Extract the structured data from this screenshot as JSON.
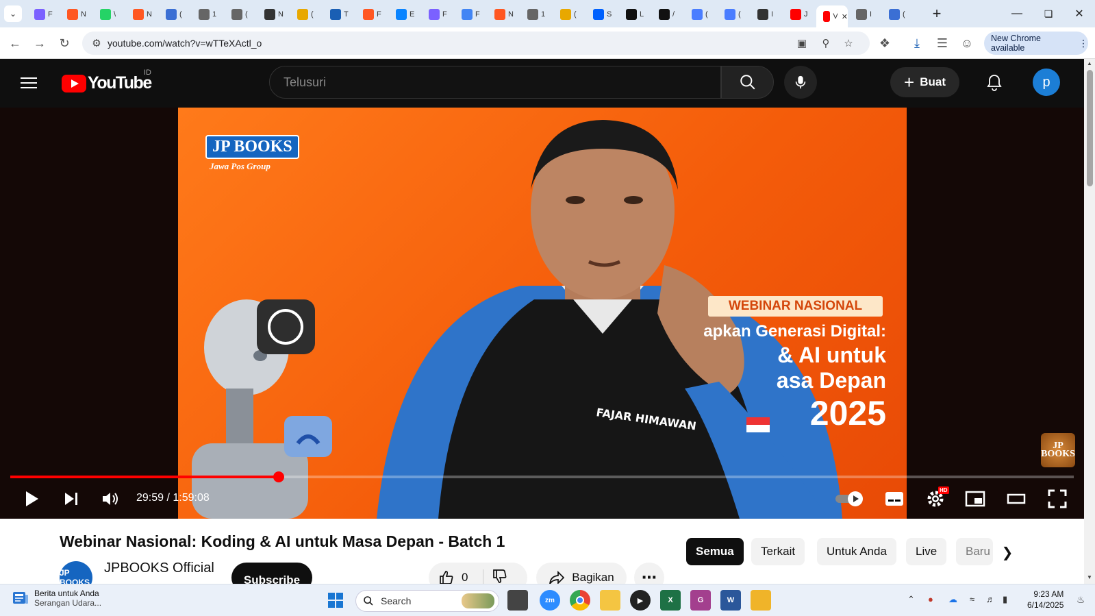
{
  "browser": {
    "tabs": [
      {
        "icon": "app-icon",
        "color": "#7b61ff",
        "text": "F"
      },
      {
        "icon": "blogger-icon",
        "color": "#ff5722",
        "text": "N"
      },
      {
        "icon": "whatsapp-icon",
        "color": "#25d366",
        "text": "\\"
      },
      {
        "icon": "blogger-icon",
        "color": "#ff5722",
        "text": "N"
      },
      {
        "icon": "doc-icon",
        "color": "#3b6fd4",
        "text": "("
      },
      {
        "icon": "globe-icon",
        "color": "#666",
        "text": "1"
      },
      {
        "icon": "globe-icon",
        "color": "#666",
        "text": "("
      },
      {
        "icon": "chatgpt-icon",
        "color": "#333",
        "text": "N"
      },
      {
        "icon": "app-icon",
        "color": "#e8a800",
        "text": "("
      },
      {
        "icon": "tm-icon",
        "color": "#1a5fb4",
        "text": "T"
      },
      {
        "icon": "blogger-icon",
        "color": "#ff5722",
        "text": "F"
      },
      {
        "icon": "edge-icon",
        "color": "#0a84ff",
        "text": "E"
      },
      {
        "icon": "app-icon",
        "color": "#7b61ff",
        "text": "F"
      },
      {
        "icon": "google-icon",
        "color": "#4285f4",
        "text": "F"
      },
      {
        "icon": "blogger-icon",
        "color": "#ff5722",
        "text": "N"
      },
      {
        "icon": "globe-icon",
        "color": "#666",
        "text": "1"
      },
      {
        "icon": "app-icon",
        "color": "#e8a800",
        "text": "("
      },
      {
        "icon": "dropbox-icon",
        "color": "#0061fe",
        "text": "S"
      },
      {
        "icon": "qr-icon",
        "color": "#111",
        "text": "L"
      },
      {
        "icon": "qr-icon",
        "color": "#111",
        "text": "/"
      },
      {
        "icon": "gemini-icon",
        "color": "#4a7dff",
        "text": "("
      },
      {
        "icon": "gemini-icon",
        "color": "#4a7dff",
        "text": "("
      },
      {
        "icon": "chatgpt-icon",
        "color": "#333",
        "text": "I"
      },
      {
        "icon": "youtube-icon",
        "color": "#ff0000",
        "text": "J"
      },
      {
        "icon": "youtube-icon",
        "color": "#ff0000",
        "text": "V",
        "active": true
      },
      {
        "icon": "globe-icon",
        "color": "#666",
        "text": "I"
      },
      {
        "icon": "app-icon",
        "color": "#3b6fd4",
        "text": "("
      }
    ],
    "url": "youtube.com/watch?v=wTTeXActl_o",
    "new_chrome_label": "New Chrome available"
  },
  "youtube": {
    "logo_text": "YouTube",
    "region": "ID",
    "search_placeholder": "Telusuri",
    "create_label": "Buat",
    "avatar_letter": "p"
  },
  "video": {
    "brand_box": "JP BOOKS",
    "brand_sub": "Jawa Pos Group",
    "banner_tag": "WEBINAR NASIONAL",
    "banner_line1": "apkan Generasi Digital:",
    "banner_line2": "& AI untuk",
    "banner_line3": "asa Depan",
    "banner_year": "2025",
    "watermark": "JP BOOKS",
    "progress": 0.2525,
    "time": "29:59 / 1:59:08",
    "hd_badge": "HD"
  },
  "meta": {
    "title": "Webinar Nasional: Koding & AI untuk Masa Depan - Batch 1",
    "channel_name": "JPBOOKS Official",
    "channel_avatar": "JP BOOKS",
    "subscribe_label": "Subscribe",
    "like_count": "0",
    "share_label": "Bagikan",
    "chips": [
      "Semua",
      "Terkait",
      "Untuk Anda",
      "Live",
      "Baru"
    ]
  },
  "taskbar": {
    "news_title": "Berita untuk Anda",
    "news_sub": "Serangan Udara...",
    "search_placeholder": "Search",
    "time": "9:23 AM",
    "date": "6/14/2025"
  }
}
